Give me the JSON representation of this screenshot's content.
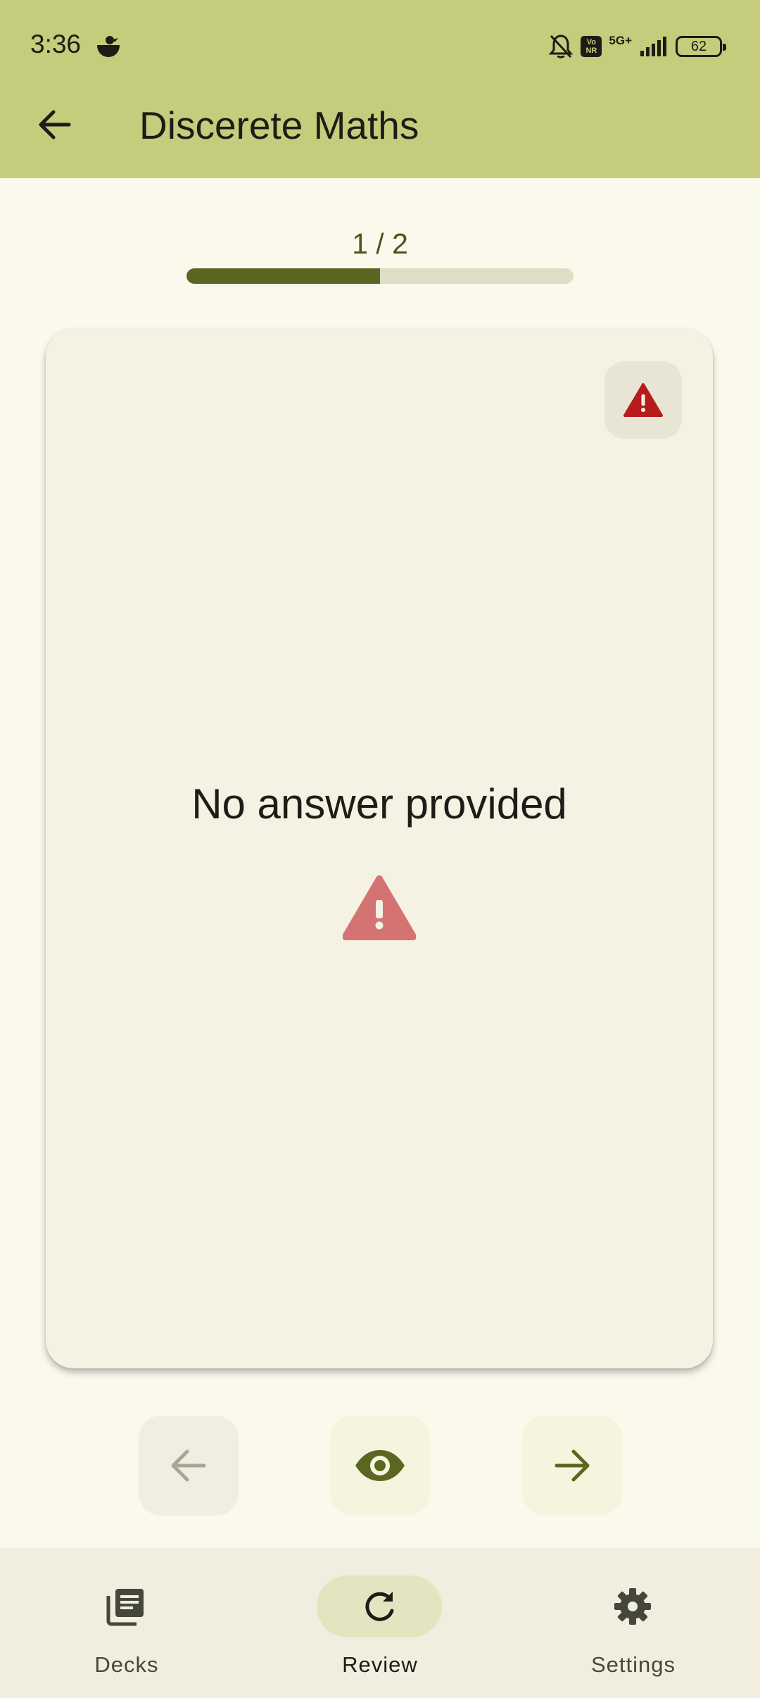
{
  "status_bar": {
    "time": "3:36",
    "network": "5G+",
    "battery": "62",
    "vonr": "Vo NR"
  },
  "app_bar": {
    "title": "Discerete Maths"
  },
  "progress": {
    "text": "1 / 2",
    "current": 1,
    "total": 2,
    "fraction": 0.5
  },
  "card": {
    "text": "No answer provided",
    "warning_icon": "warning-icon"
  },
  "controls": {
    "prev_icon": "arrow-left-icon",
    "flip_icon": "eye-icon",
    "next_icon": "arrow-right-icon"
  },
  "bottom_nav": {
    "items": [
      {
        "label": "Decks",
        "icon": "decks-icon",
        "active": false
      },
      {
        "label": "Review",
        "icon": "refresh-icon",
        "active": true
      },
      {
        "label": "Settings",
        "icon": "gear-icon",
        "active": false
      }
    ]
  },
  "colors": {
    "app_bar": "#c5cc7c",
    "background": "#fbf9ec",
    "accent": "#5b6621",
    "warning": "#b71c1c",
    "warning_light": "#d57373"
  }
}
